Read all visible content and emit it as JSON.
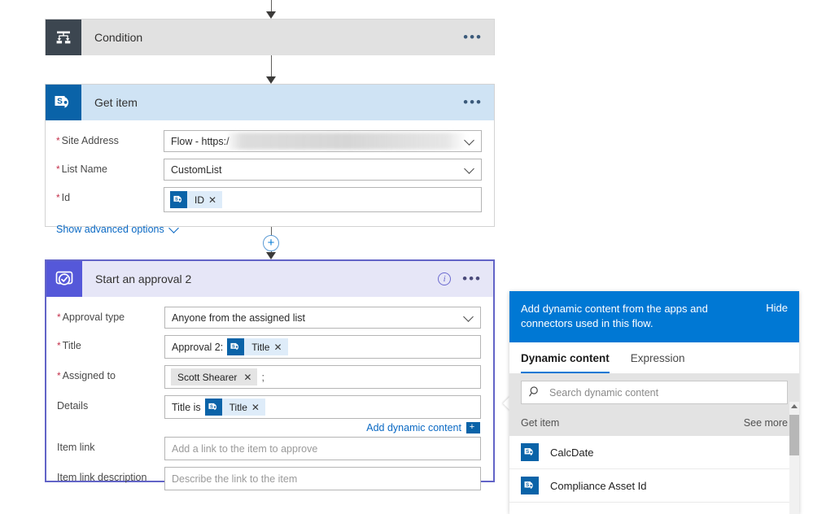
{
  "flow": {
    "condition_card": {
      "title": "Condition",
      "icon": "condition-branch-icon",
      "more_label": "•••"
    },
    "get_item_card": {
      "title": "Get item",
      "icon": "sharepoint-icon",
      "more_label": "•••",
      "fields": [
        {
          "label": "Site Address",
          "required": true,
          "value": "Flow - https:/",
          "redacted": true,
          "control": "dropdown"
        },
        {
          "label": "List Name",
          "required": true,
          "value": "CustomList",
          "control": "dropdown"
        },
        {
          "label": "Id",
          "required": true,
          "control": "token-input",
          "token": "ID"
        }
      ],
      "advanced_options_label": "Show advanced options"
    },
    "approval_card": {
      "title": "Start an approval 2",
      "icon": "approvals-icon",
      "info_label": "i",
      "more_label": "•••",
      "approval_type": {
        "label": "Approval type",
        "required": true,
        "value": "Anyone from the assigned list"
      },
      "title_field": {
        "label": "Title",
        "required": true,
        "prefix_text": "Approval 2:",
        "token": "Title"
      },
      "assigned_to": {
        "label": "Assigned to",
        "required": true,
        "person": "Scott Shearer",
        "separator": ";"
      },
      "details": {
        "label": "Details",
        "required": false,
        "prefix_text": "Title is",
        "token": "Title"
      },
      "add_dynamic_content_label": "Add dynamic content",
      "item_link": {
        "label": "Item link",
        "placeholder": "Add a link to the item to approve",
        "value": ""
      },
      "item_link_description": {
        "label": "Item link description",
        "placeholder": "Describe the link to the item",
        "value": ""
      }
    },
    "insert_button_label": "+"
  },
  "dynamic_content_panel": {
    "banner_text": "Add dynamic content from the apps and connectors used in this flow.",
    "hide_label": "Hide",
    "tabs": [
      {
        "label": "Dynamic content",
        "active": true
      },
      {
        "label": "Expression",
        "active": false
      }
    ],
    "search": {
      "placeholder": "Search dynamic content",
      "value": "",
      "icon": "search-icon"
    },
    "group": {
      "name": "Get item",
      "see_more_label": "See more"
    },
    "items": [
      {
        "label": "CalcDate",
        "icon": "sharepoint-icon"
      },
      {
        "label": "Compliance Asset Id",
        "icon": "sharepoint-icon"
      }
    ]
  },
  "colors": {
    "accent_blue": "#0078d4",
    "sharepoint_blue": "#0a63a8",
    "approvals_purple": "#5558d9",
    "condition_gray": "#3c4650",
    "required_red": "#c4314b",
    "token_bg": "#deecf9",
    "link_blue": "#0a69c4"
  }
}
